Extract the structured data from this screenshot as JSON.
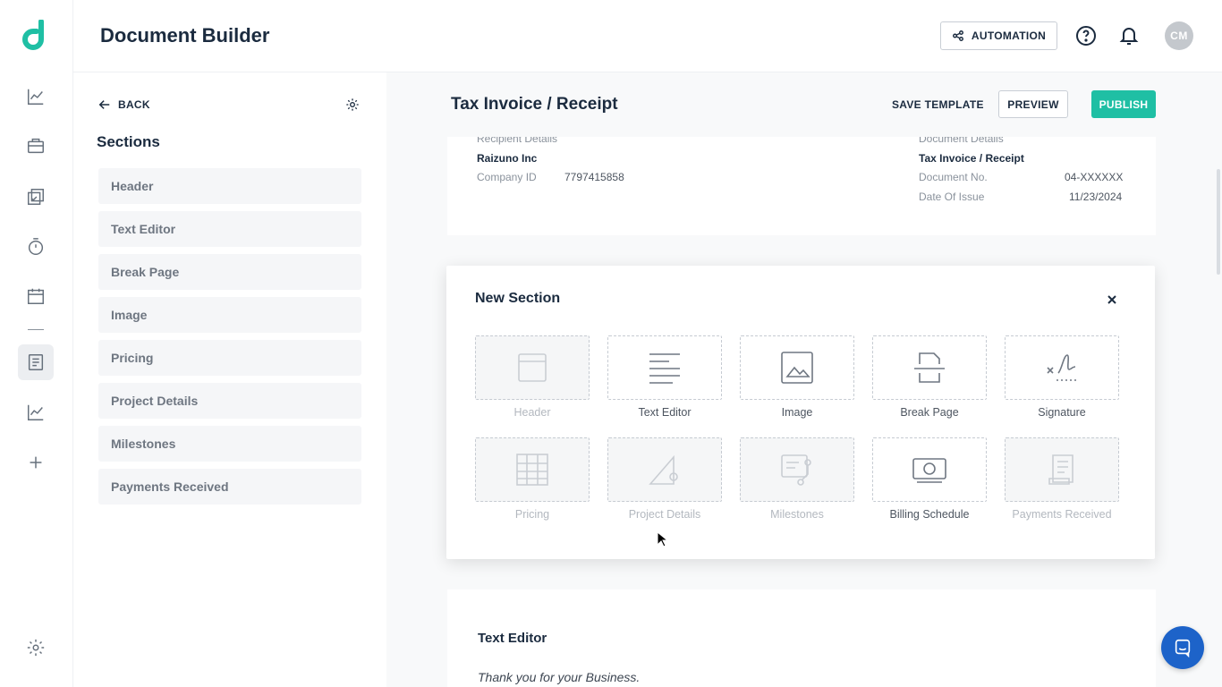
{
  "app": {
    "title": "Document Builder",
    "accent_color": "#1fbfa4",
    "automation_label": "AUTOMATION",
    "avatar_initials": "CM"
  },
  "rail": {
    "items": [
      "analytics-icon",
      "briefcase-icon",
      "tasks-icon",
      "timer-icon",
      "calendar-icon",
      "document-icon",
      "reports-icon",
      "add-icon"
    ],
    "active": "document-icon"
  },
  "sections_panel": {
    "back_label": "BACK",
    "title": "Sections",
    "items": [
      {
        "label": "Header"
      },
      {
        "label": "Text Editor"
      },
      {
        "label": "Break Page"
      },
      {
        "label": "Image"
      },
      {
        "label": "Pricing"
      },
      {
        "label": "Project Details"
      },
      {
        "label": "Milestones"
      },
      {
        "label": "Payments Received"
      }
    ]
  },
  "document": {
    "title": "Tax Invoice / Receipt",
    "save_template_label": "SAVE TEMPLATE",
    "preview_label": "PREVIEW",
    "publish_label": "PUBLISH",
    "recipient": {
      "heading": "Recipient Details",
      "company": "Raizuno Inc",
      "company_id_label": "Company ID",
      "company_id": "7797415858"
    },
    "doc_details": {
      "heading": "Document Details",
      "name": "Tax Invoice / Receipt",
      "number_label": "Document No.",
      "number": "04-XXXXXX",
      "date_label": "Date Of Issue",
      "date": "11/23/2024"
    },
    "text_editor": {
      "title": "Text Editor",
      "body": "Thank you for your Business."
    }
  },
  "modal": {
    "title": "New Section",
    "tiles": [
      {
        "label": "Header",
        "icon": "header-icon",
        "enabled": false
      },
      {
        "label": "Text Editor",
        "icon": "text-editor-icon",
        "enabled": true
      },
      {
        "label": "Image",
        "icon": "image-icon",
        "enabled": true
      },
      {
        "label": "Break Page",
        "icon": "break-page-icon",
        "enabled": true
      },
      {
        "label": "Signature",
        "icon": "signature-icon",
        "enabled": true
      },
      {
        "label": "Pricing",
        "icon": "pricing-icon",
        "enabled": false
      },
      {
        "label": "Project Details",
        "icon": "project-details-icon",
        "enabled": false
      },
      {
        "label": "Milestones",
        "icon": "milestones-icon",
        "enabled": false
      },
      {
        "label": "Billing Schedule",
        "icon": "billing-schedule-icon",
        "enabled": true
      },
      {
        "label": "Payments Received",
        "icon": "payments-received-icon",
        "enabled": false
      }
    ]
  }
}
